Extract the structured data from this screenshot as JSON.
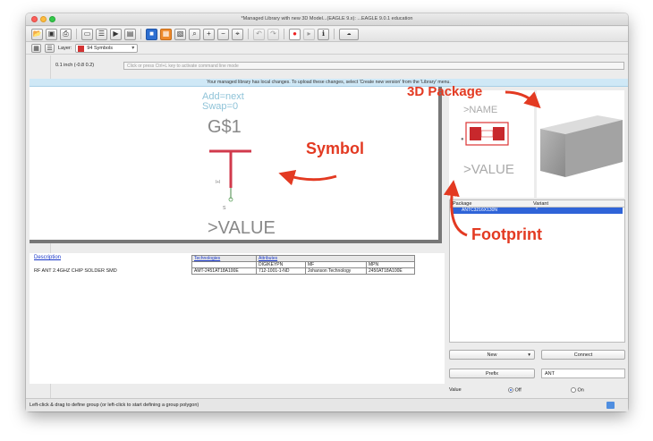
{
  "window": {
    "title": "*Managed Library with new 3D Model...(EAGLE 9.x): ...EAGLE 9.0.1 education"
  },
  "toolbar": {
    "buttons": [
      "open-icon",
      "save-icon",
      "print-icon",
      "book-icon",
      "script-icon",
      "run-ulp-icon",
      "cam-icon",
      "symbol-icon",
      "package-icon",
      "device-icon",
      "zoom-fit-icon",
      "zoom-in-icon",
      "zoom-out-icon",
      "zoom-select-icon",
      "zoom-box-icon",
      "undo-icon",
      "redo-icon",
      "stop-icon",
      "go-icon",
      "info-icon",
      "fusion-icon"
    ]
  },
  "layer": {
    "label": "Layer:",
    "value": "94 Symbols",
    "color": "#d33333"
  },
  "command": {
    "coords": "0.1 inch (-0.8 0.2)",
    "placeholder": "Click or press Ctrl+L key to activate command line mode"
  },
  "notice": {
    "text": "Your managed library has local changes. To upload these changes, select 'Create new version' from the 'Library' menu."
  },
  "symbol": {
    "texts": [
      "Add=next",
      "Swap=0",
      "G$1",
      ">VALUE"
    ],
    "pin_label": "s"
  },
  "description": {
    "link": "Description",
    "text": "RF ANT 2.4GHZ CHIP SOLDER SMD"
  },
  "attributes": {
    "headers": [
      "Technologies",
      "Attributes"
    ],
    "columns": [
      "DIGIKEYPN",
      "MF",
      "MPN"
    ],
    "row": [
      "AMT-2451AT18A100E",
      "712-1001-1-ND",
      "Johanson Technology",
      "2450AT18A100E"
    ]
  },
  "package_preview": {
    "texts": [
      ">NAME",
      ">VALUE"
    ]
  },
  "variants": {
    "headers": [
      "Package",
      "Variant"
    ],
    "rows": [
      {
        "package": "ANTC3216X130N",
        "variant": "*"
      }
    ]
  },
  "buttons": {
    "new": "New",
    "connect": "Connect",
    "prefix": "Prefix",
    "prefix_value": "ANT",
    "value_label": "Value",
    "off": "Off",
    "on": "On"
  },
  "status": {
    "text": "Left-click & drag to define group (or left-click to start defining a group polygon)"
  },
  "annotations": {
    "symbol": "Symbol",
    "package_3d": "3D Package",
    "footprint": "Footprint"
  }
}
